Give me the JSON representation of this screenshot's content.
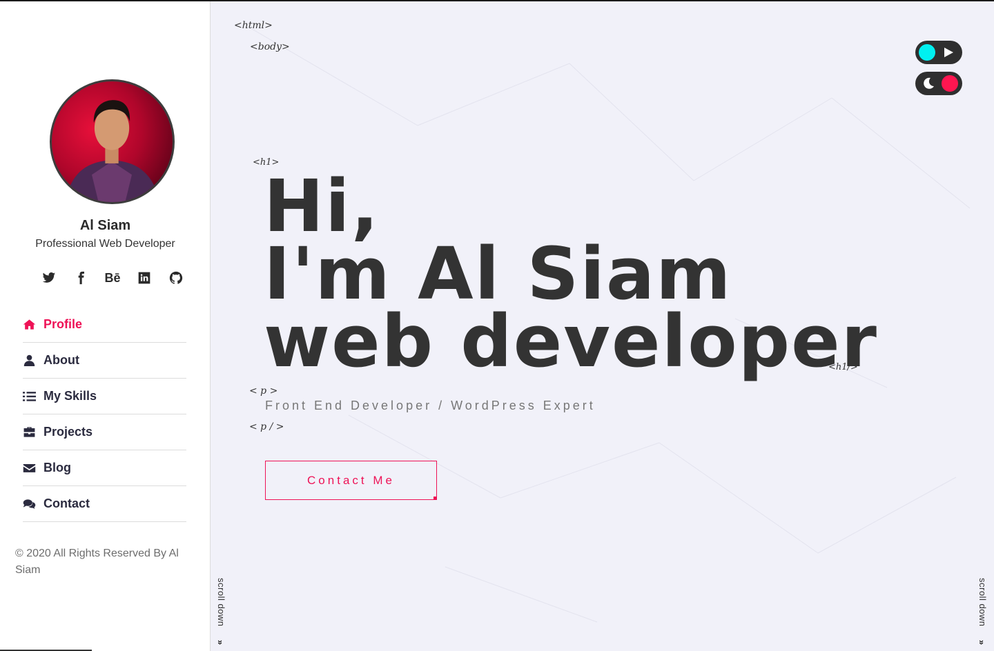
{
  "profile": {
    "name": "Al Siam",
    "role": "Professional Web Developer"
  },
  "socials": [
    {
      "icon": "twitter-icon"
    },
    {
      "icon": "facebook-icon"
    },
    {
      "icon": "behance-icon",
      "label": "Bē"
    },
    {
      "icon": "linkedin-icon"
    },
    {
      "icon": "github-icon"
    }
  ],
  "nav": {
    "items": [
      {
        "label": "Profile",
        "icon": "home-icon",
        "active": true
      },
      {
        "label": "About",
        "icon": "user-icon"
      },
      {
        "label": "My Skills",
        "icon": "list-icon"
      },
      {
        "label": "Projects",
        "icon": "briefcase-icon"
      },
      {
        "label": "Blog",
        "icon": "envelope-icon"
      },
      {
        "label": "Contact",
        "icon": "comments-icon"
      }
    ]
  },
  "footer": {
    "copyright": "© 2020 All Rights Reserved By Al Siam"
  },
  "tags": {
    "html": "<html>",
    "body": "<body>",
    "h1_open": "<h1>",
    "h1_close": "<h1/>",
    "p_open": "< p >",
    "p_close": "< p / >"
  },
  "hero": {
    "line1": "Hi,",
    "line2": "I'm Al Siam",
    "line3": "web developer",
    "subtitle": "Front End Developer / WordPress Expert",
    "cta": "Contact Me"
  },
  "scroll": {
    "label": "scroll down",
    "chevron": "»"
  },
  "colors": {
    "accent": "#ee1256",
    "toggle_play": "#00f0f0",
    "toggle_dark": "#ff1650",
    "text_dark": "#333333"
  }
}
